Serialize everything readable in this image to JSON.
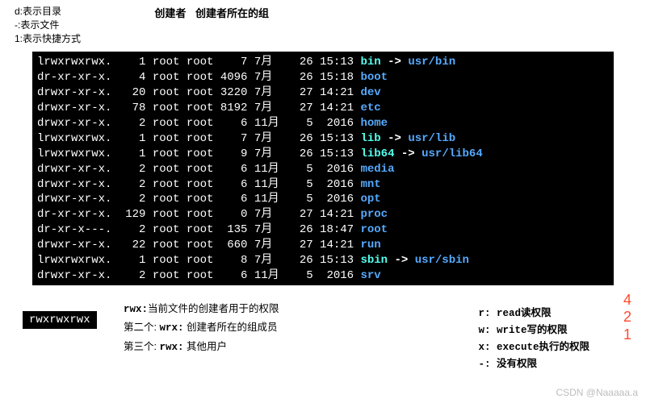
{
  "top_legend": {
    "d": "d:表示目录",
    "dash": "-:表示文件",
    "one": "1:表示快捷方式",
    "creator": "创建者",
    "group": "创建者所在的组"
  },
  "terminal": [
    {
      "perm": "lrwxrwxrwx.",
      "links": "1",
      "own": "root",
      "grp": "root",
      "size": "7",
      "mon": "7月",
      "day": "26",
      "time": "15:13",
      "name": "bin",
      "sym": true,
      "target": "usr/bin"
    },
    {
      "perm": "dr-xr-xr-x.",
      "links": "4",
      "own": "root",
      "grp": "root",
      "size": "4096",
      "mon": "7月",
      "day": "26",
      "time": "15:18",
      "name": "boot",
      "sym": false
    },
    {
      "perm": "drwxr-xr-x.",
      "links": "20",
      "own": "root",
      "grp": "root",
      "size": "3220",
      "mon": "7月",
      "day": "27",
      "time": "14:21",
      "name": "dev",
      "sym": false
    },
    {
      "perm": "drwxr-xr-x.",
      "links": "78",
      "own": "root",
      "grp": "root",
      "size": "8192",
      "mon": "7月",
      "day": "27",
      "time": "14:21",
      "name": "etc",
      "sym": false
    },
    {
      "perm": "drwxr-xr-x.",
      "links": "2",
      "own": "root",
      "grp": "root",
      "size": "6",
      "mon": "11月",
      "day": "5",
      "time": "2016",
      "name": "home",
      "sym": false
    },
    {
      "perm": "lrwxrwxrwx.",
      "links": "1",
      "own": "root",
      "grp": "root",
      "size": "7",
      "mon": "7月",
      "day": "26",
      "time": "15:13",
      "name": "lib",
      "sym": true,
      "target": "usr/lib"
    },
    {
      "perm": "lrwxrwxrwx.",
      "links": "1",
      "own": "root",
      "grp": "root",
      "size": "9",
      "mon": "7月",
      "day": "26",
      "time": "15:13",
      "name": "lib64",
      "sym": true,
      "target": "usr/lib64"
    },
    {
      "perm": "drwxr-xr-x.",
      "links": "2",
      "own": "root",
      "grp": "root",
      "size": "6",
      "mon": "11月",
      "day": "5",
      "time": "2016",
      "name": "media",
      "sym": false
    },
    {
      "perm": "drwxr-xr-x.",
      "links": "2",
      "own": "root",
      "grp": "root",
      "size": "6",
      "mon": "11月",
      "day": "5",
      "time": "2016",
      "name": "mnt",
      "sym": false
    },
    {
      "perm": "drwxr-xr-x.",
      "links": "2",
      "own": "root",
      "grp": "root",
      "size": "6",
      "mon": "11月",
      "day": "5",
      "time": "2016",
      "name": "opt",
      "sym": false
    },
    {
      "perm": "dr-xr-xr-x.",
      "links": "129",
      "own": "root",
      "grp": "root",
      "size": "0",
      "mon": "7月",
      "day": "27",
      "time": "14:21",
      "name": "proc",
      "sym": false
    },
    {
      "perm": "dr-xr-x---.",
      "links": "2",
      "own": "root",
      "grp": "root",
      "size": "135",
      "mon": "7月",
      "day": "26",
      "time": "18:47",
      "name": "root",
      "sym": false
    },
    {
      "perm": "drwxr-xr-x.",
      "links": "22",
      "own": "root",
      "grp": "root",
      "size": "660",
      "mon": "7月",
      "day": "27",
      "time": "14:21",
      "name": "run",
      "sym": false
    },
    {
      "perm": "lrwxrwxrwx.",
      "links": "1",
      "own": "root",
      "grp": "root",
      "size": "8",
      "mon": "7月",
      "day": "26",
      "time": "15:13",
      "name": "sbin",
      "sym": true,
      "target": "usr/sbin"
    },
    {
      "perm": "drwxr-xr-x.",
      "links": "2",
      "own": "root",
      "grp": "root",
      "size": "6",
      "mon": "11月",
      "day": "5",
      "time": "2016",
      "name": "srv",
      "sym": false
    }
  ],
  "bottom": {
    "pill": "rwxrwxrwx",
    "l1_label": "rwx:",
    "l1_text": "当前文件的创建者用于的权限",
    "l2_label": "第二个:",
    "l2_code": "wrx:",
    "l2_text": "创建者所在的组成员",
    "l3_label": "第三个:",
    "l3_code": "rwx:",
    "l3_text": "其他用户"
  },
  "rwx_legend": {
    "r": "r: read读权限",
    "w": "w: write写的权限",
    "x": "x: execute执行的权限",
    "dash": "-: 没有权限"
  },
  "reds": {
    "a": "4",
    "b": "2",
    "c": "1"
  },
  "watermark": "CSDN @Naaaaa.a"
}
